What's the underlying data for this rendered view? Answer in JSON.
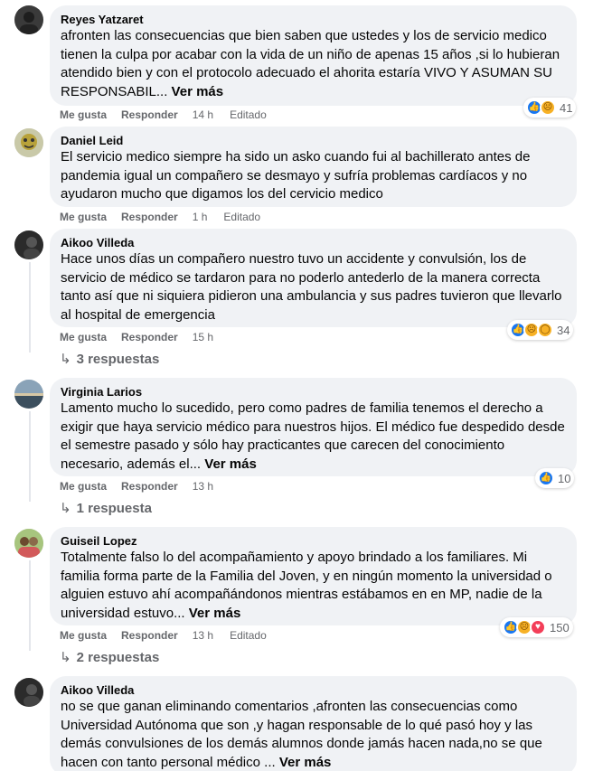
{
  "comments": [
    {
      "author": "Reyes Yatzaret",
      "text": "afronten las consecuencias que bien saben que ustedes y los de servicio medico tienen la culpa por acabar con la vida de un niño de apenas 15 años ,si lo hubieran atendido bien y con el protocolo adecuado el ahorita estaría VIVO Y ASUMAN SU RESPONSABIL...",
      "more": "Ver más",
      "like": "Me gusta",
      "reply": "Responder",
      "time": "14 h",
      "edited": "Editado",
      "reactions": [
        "like-reaction-icon",
        "sad-reaction-icon"
      ],
      "reaction_count": "41"
    },
    {
      "author": "Daniel Leid",
      "text": "El servicio medico siempre ha sido un asko cuando fui al bachillerato antes de pandemia igual un compañero se desmayo y sufría problemas cardíacos y no ayudaron mucho que digamos los del cervicio medico",
      "more": "",
      "like": "Me gusta",
      "reply": "Responder",
      "time": "1 h",
      "edited": "Editado"
    },
    {
      "author": "Aikoo Villeda",
      "text": "Hace unos días un compañero nuestro tuvo un accidente y convulsión, los de servicio de médico se tardaron para no poderlo antederlo de la manera correcta tanto así que ni siquiera pidieron una ambulancia y sus padres tuvieron que llevarlo al hospital de emergencia",
      "more": "",
      "like": "Me gusta",
      "reply": "Responder",
      "time": "15 h",
      "reactions": [
        "like-reaction-icon",
        "sad-reaction-icon",
        "wow-reaction-icon"
      ],
      "reaction_count": "34",
      "replies": "3 respuestas"
    },
    {
      "author": "Virginia Larios",
      "text": "Lamento mucho lo sucedido, pero como padres de familia tenemos el derecho a exigir que haya servicio médico para nuestros hijos. El médico fue despedido desde el semestre pasado y sólo hay practicantes que carecen del conocimiento necesario, además el...",
      "more": "Ver más",
      "like": "Me gusta",
      "reply": "Responder",
      "time": "13 h",
      "reactions": [
        "like-reaction-icon"
      ],
      "reaction_count": "10",
      "replies": "1 respuesta"
    },
    {
      "author": "Guiseil Lopez",
      "text": "Totalmente falso lo del acompañamiento y apoyo brindado a los familiares. Mi familia forma parte de la Familia del Joven, y en ningún momento la universidad o alguien estuvo ahí acompañándonos mientras estábamos en en MP, nadie de la universidad estuvo...",
      "more": "Ver más",
      "like": "Me gusta",
      "reply": "Responder",
      "time": "13 h",
      "edited": "Editado",
      "reactions": [
        "like-reaction-icon",
        "sad-reaction-icon",
        "love-reaction-icon"
      ],
      "reaction_count": "150",
      "replies": "2 respuestas"
    },
    {
      "author": "Aikoo Villeda",
      "text": "no se que ganan eliminando comentarios ,afronten las consecuencias como Universidad Autónoma que son ,y hagan responsable de lo qué pasó hoy y las demás convulsiones de los demás alumnos donde jamás hacen nada,no se que hacen con tanto personal médico ...",
      "more": "Ver más"
    }
  ],
  "colors": {
    "bubble": "#f0f2f5",
    "meta": "#65676b",
    "like_blue": "#1877f2",
    "reaction_yellow": "#f7b125",
    "love_red": "#f33e58"
  }
}
